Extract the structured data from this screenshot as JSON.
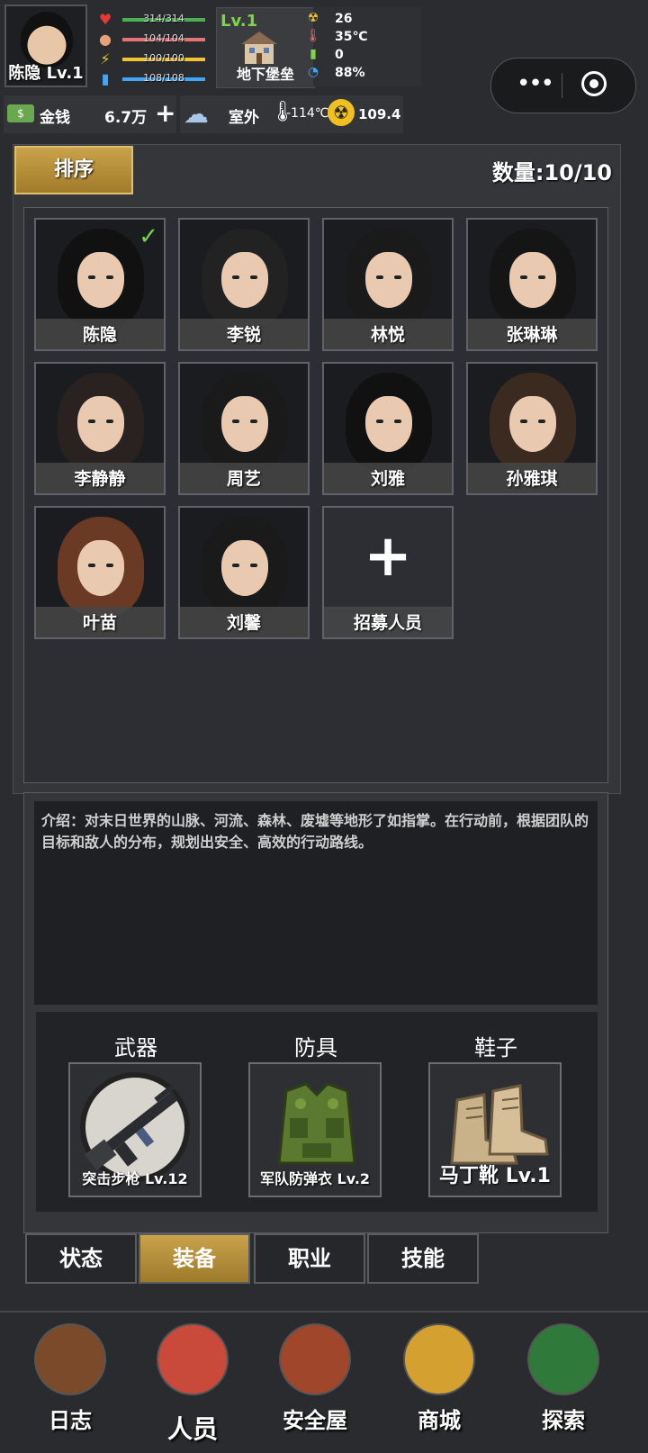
{
  "player": {
    "name_level": "陈隐 Lv.1"
  },
  "stats": [
    {
      "icon": "heart-icon",
      "text": "314/314",
      "ratio": 1.0,
      "color": "#4caf50"
    },
    {
      "icon": "stomach-icon",
      "text": "104/104",
      "ratio": 1.0,
      "color": "#e57373"
    },
    {
      "icon": "energy-icon",
      "text": "100/100",
      "ratio": 1.0,
      "color": "#f4c430"
    },
    {
      "icon": "water-icon",
      "text": "108/108",
      "ratio": 1.0,
      "color": "#42a5f5"
    }
  ],
  "base": {
    "level": "Lv.1",
    "name": "地下堡垒"
  },
  "env": {
    "radiation": "26",
    "temperature": "35℃",
    "power": "0",
    "percent": "88%"
  },
  "money": {
    "label": "金钱",
    "value": "6.7万",
    "plus": "+"
  },
  "weather": {
    "label": "室外",
    "temp": "-114℃",
    "radiation": "109.4"
  },
  "panel": {
    "sort_label": "排序",
    "count_label": "数量:10/10"
  },
  "characters": [
    {
      "name": "陈隐",
      "selected": true,
      "hair": "#111"
    },
    {
      "name": "李锐",
      "selected": false,
      "hair": "#222"
    },
    {
      "name": "林悦",
      "selected": false,
      "hair": "#1a1a1a"
    },
    {
      "name": "张琳琳",
      "selected": false,
      "hair": "#151515"
    },
    {
      "name": "李静静",
      "selected": false,
      "hair": "#2a2220"
    },
    {
      "name": "周艺",
      "selected": false,
      "hair": "#1a1a1a"
    },
    {
      "name": "刘雅",
      "selected": false,
      "hair": "#111"
    },
    {
      "name": "孙雅琪",
      "selected": false,
      "hair": "#3a2a20"
    },
    {
      "name": "叶苗",
      "selected": false,
      "hair": "#6a3a24"
    },
    {
      "name": "刘馨",
      "selected": false,
      "hair": "#1a1a1a"
    }
  ],
  "recruit": {
    "label": "招募人员",
    "plus": "+"
  },
  "intro": {
    "text": "介绍：对末日世界的山脉、河流、森林、废墟等地形了如指掌。在行动前，根据团队的目标和敌人的分布，规划出安全、高效的行动路线。"
  },
  "equipment": [
    {
      "slot": "武器",
      "item": "突击步枪 Lv.12",
      "icon": "rifle-icon"
    },
    {
      "slot": "防具",
      "item": "军队防弹衣 Lv.2",
      "icon": "vest-icon"
    },
    {
      "slot": "鞋子",
      "item": "马丁靴 Lv.1",
      "icon": "boots-icon"
    }
  ],
  "tabs": [
    {
      "label": "状态",
      "active": false
    },
    {
      "label": "装备",
      "active": true
    },
    {
      "label": "职业",
      "active": false
    },
    {
      "label": "技能",
      "active": false
    }
  ],
  "nav": [
    {
      "label": "日志",
      "icon": "book-icon"
    },
    {
      "label": "人员",
      "icon": "id-card-icon"
    },
    {
      "label": "安全屋",
      "icon": "house-icon"
    },
    {
      "label": "商城",
      "icon": "basket-icon"
    },
    {
      "label": "探索",
      "icon": "radar-icon"
    }
  ],
  "capsule": {
    "more": "•••"
  }
}
